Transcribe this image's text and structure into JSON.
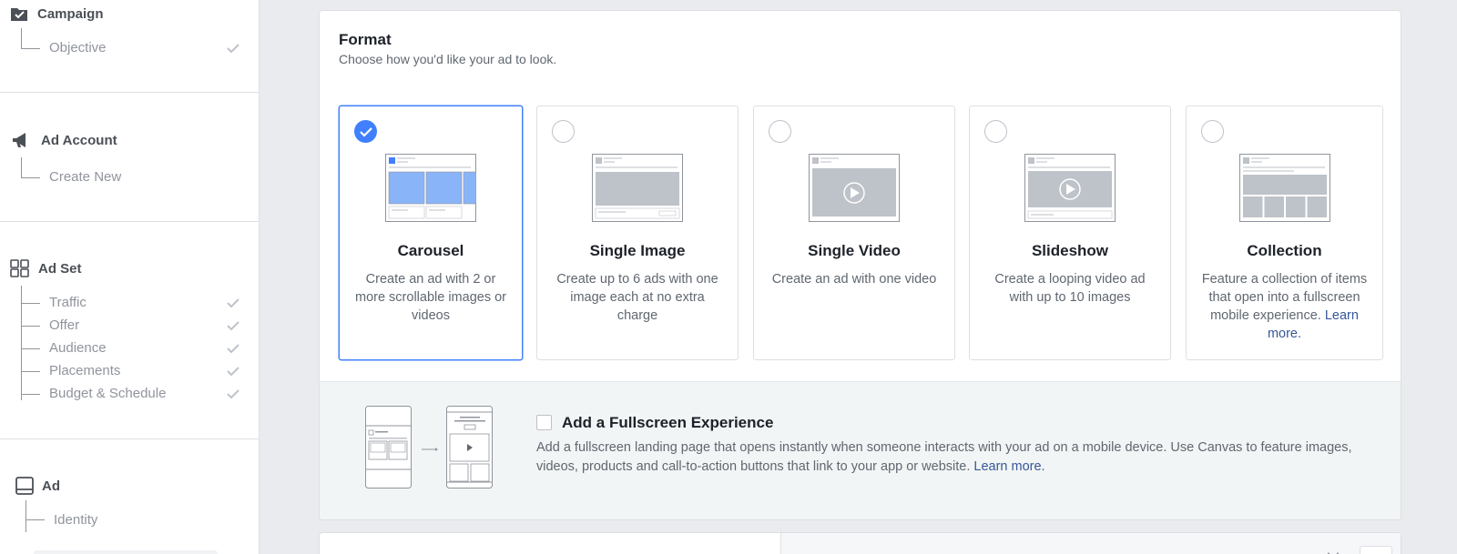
{
  "sidebar": {
    "campaign": {
      "title": "Campaign",
      "items": [
        {
          "label": "Objective",
          "done": true
        }
      ]
    },
    "ad_account": {
      "title": "Ad Account",
      "items": [
        {
          "label": "Create New",
          "done": false
        }
      ]
    },
    "ad_set": {
      "title": "Ad Set",
      "items": [
        {
          "label": "Traffic",
          "done": true
        },
        {
          "label": "Offer",
          "done": true
        },
        {
          "label": "Audience",
          "done": true
        },
        {
          "label": "Placements",
          "done": true
        },
        {
          "label": "Budget & Schedule",
          "done": true
        }
      ]
    },
    "ad": {
      "title": "Ad",
      "items": [
        {
          "label": "Identity",
          "done": false
        }
      ]
    }
  },
  "format": {
    "title": "Format",
    "subtitle": "Choose how you'd like your ad to look.",
    "selected": "carousel",
    "cards": [
      {
        "id": "carousel",
        "title": "Carousel",
        "desc": "Create an ad with 2 or more scrollable images or videos",
        "selected": true
      },
      {
        "id": "single-image",
        "title": "Single Image",
        "desc": "Create up to 6 ads with one image each at no extra charge",
        "selected": false
      },
      {
        "id": "single-video",
        "title": "Single Video",
        "desc": "Create an ad with one video",
        "selected": false
      },
      {
        "id": "slideshow",
        "title": "Slideshow",
        "desc": "Create a looping video ad with up to 10 images",
        "selected": false
      },
      {
        "id": "collection",
        "title": "Collection",
        "desc": "Feature a collection of items that open into a fullscreen mobile experience.",
        "link": "Learn more.",
        "selected": false
      }
    ]
  },
  "fullscreen": {
    "title": "Add a Fullscreen Experience",
    "checked": false,
    "desc": "Add a fullscreen landing page that opens instantly when someone interacts with your ad on a mobile device. Use Canvas to feature images, videos, products and call-to-action buttons that link to your app or website.",
    "link": "Learn more."
  },
  "colors": {
    "accent": "#4080ff",
    "link": "#365899",
    "muted": "#90949c"
  }
}
